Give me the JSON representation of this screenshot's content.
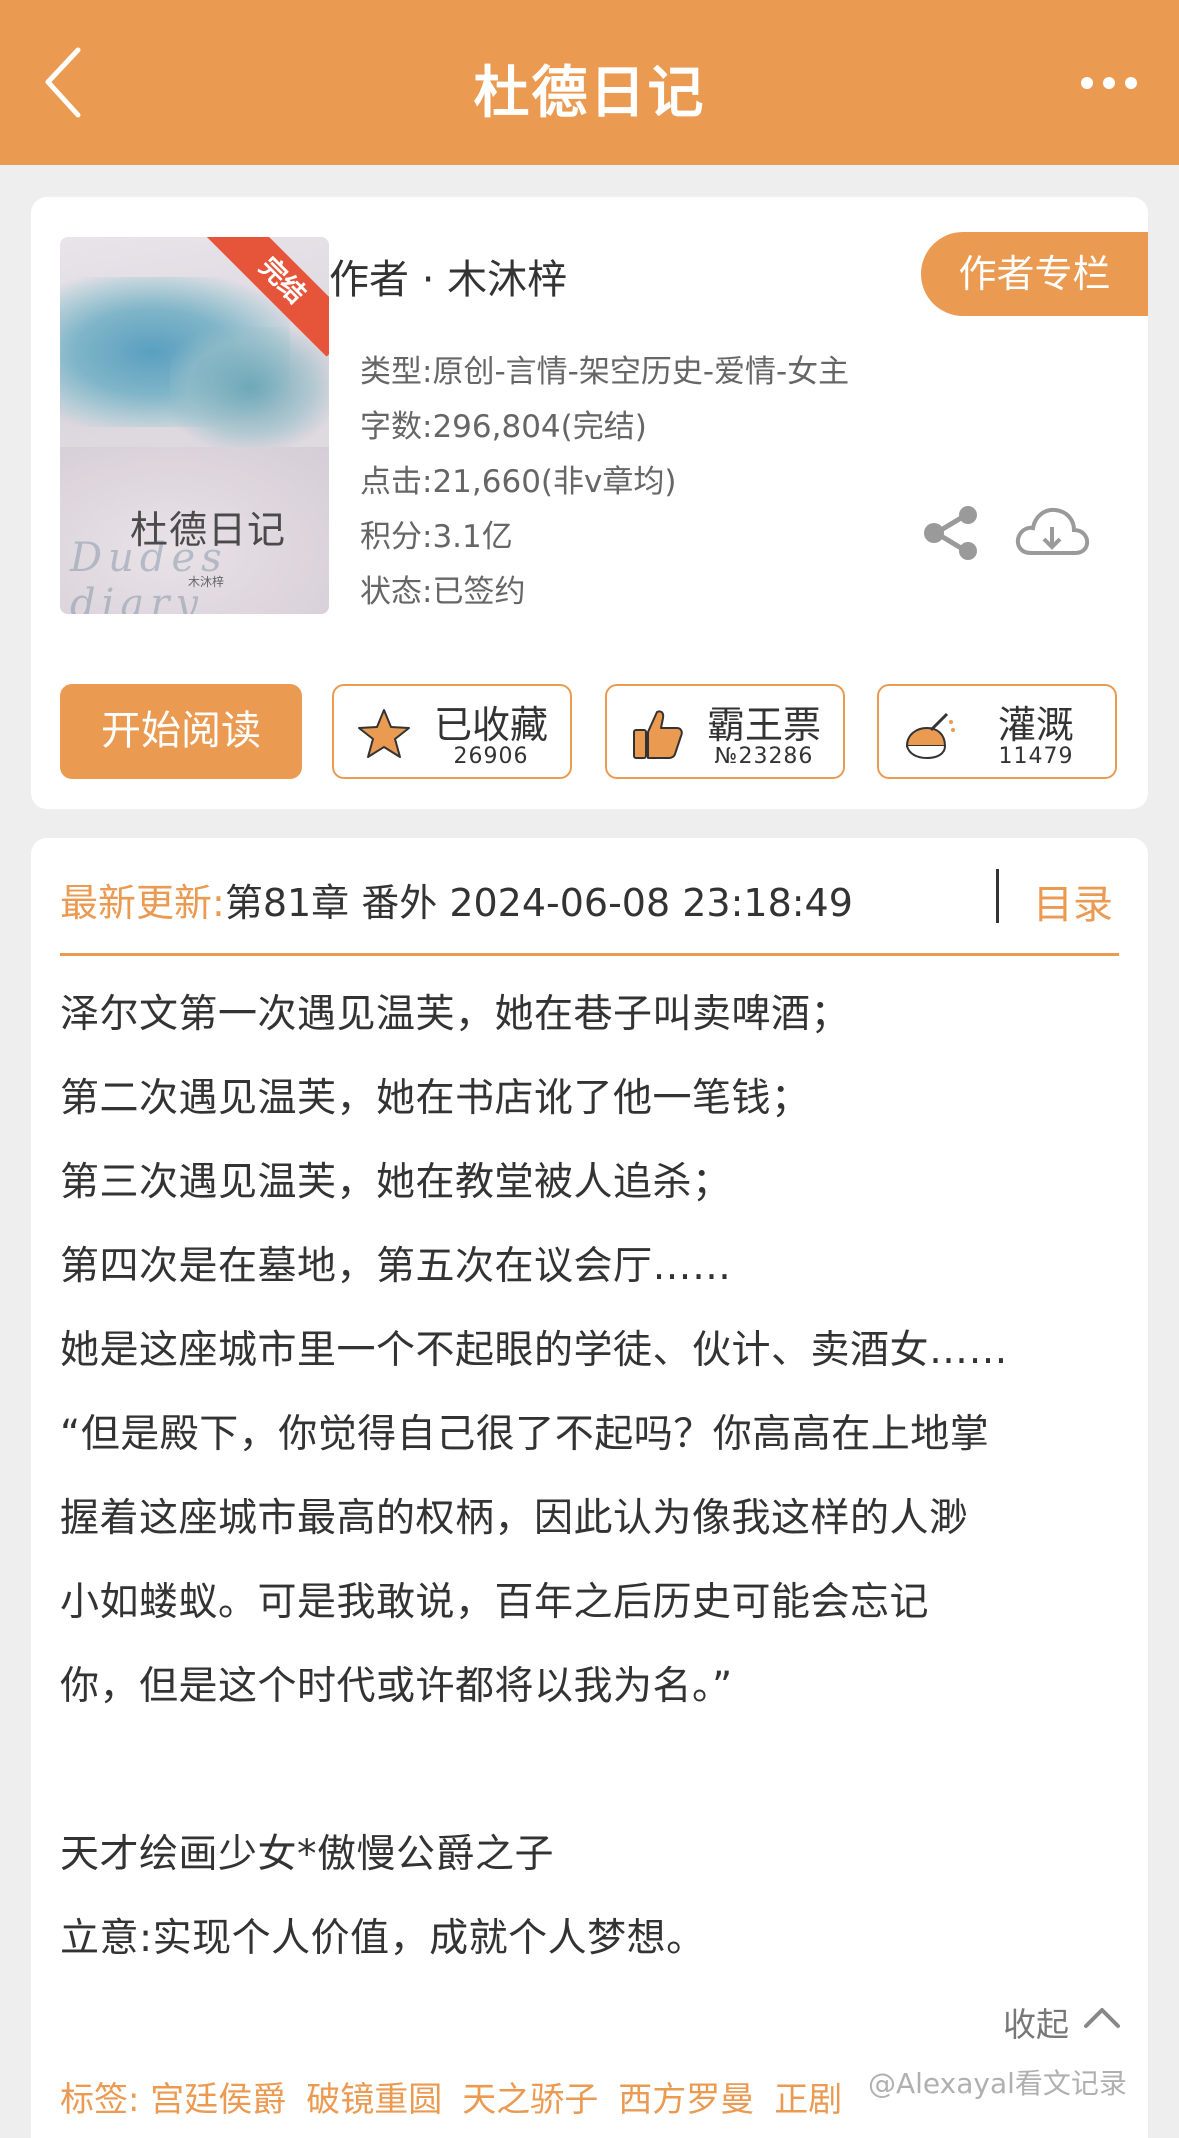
{
  "header": {
    "title": "杜德日记",
    "back_icon": "chevron-left-icon",
    "more_icon": "more-horizontal-icon",
    "bg_color": "#eb9a52"
  },
  "book": {
    "cover_title": "杜德日记",
    "cover_script": "Dudes diary",
    "cover_author": "木沐梓",
    "ribbon": "完结",
    "author_line": "作者 · 木沐梓",
    "author_column_button": "作者专栏",
    "meta": [
      "类型:原创-言情-架空历史-爱情-女主",
      "字数:296,804(完结)",
      "点击:21,660(非v章均)",
      "积分:3.1亿",
      "状态:已签约"
    ]
  },
  "actions": {
    "read": "开始阅读",
    "collect": {
      "label": "已收藏",
      "count": "26906"
    },
    "vote": {
      "label": "霸王票",
      "count": "№23286"
    },
    "water": {
      "label": "灌溉",
      "count": "11479"
    }
  },
  "update": {
    "label": "最新更新:",
    "text": "第81章 番外 2024-06-08 23:18:49",
    "toc": "目录"
  },
  "description": [
    "泽尔文第一次遇见温芙，她在巷子叫卖啤酒；",
    "第二次遇见温芙，她在书店讹了他一笔钱；",
    "第三次遇见温芙，她在教堂被人追杀；",
    "第四次是在墓地，第五次在议会厅……",
    "她是这座城市里一个不起眼的学徒、伙计、卖酒女……",
    "“但是殿下，你觉得自己很了不起吗？你高高在上地掌",
    "握着这座城市最高的权柄，因此认为像我这样的人渺",
    "小如蝼蚁。可是我敢说，百年之后历史可能会忘记",
    "你，但是这个时代或许都将以我为名。”",
    "天才绘画少女*傲慢公爵之子",
    "立意:实现个人价值，成就个人梦想。"
  ],
  "collapse": "收起",
  "tags": {
    "label": "标签:",
    "items": [
      "宫廷侯爵",
      "破镜重圆",
      "天之骄子",
      "西方罗曼",
      "正剧"
    ]
  },
  "watermark": "@Alexayal看文记录"
}
